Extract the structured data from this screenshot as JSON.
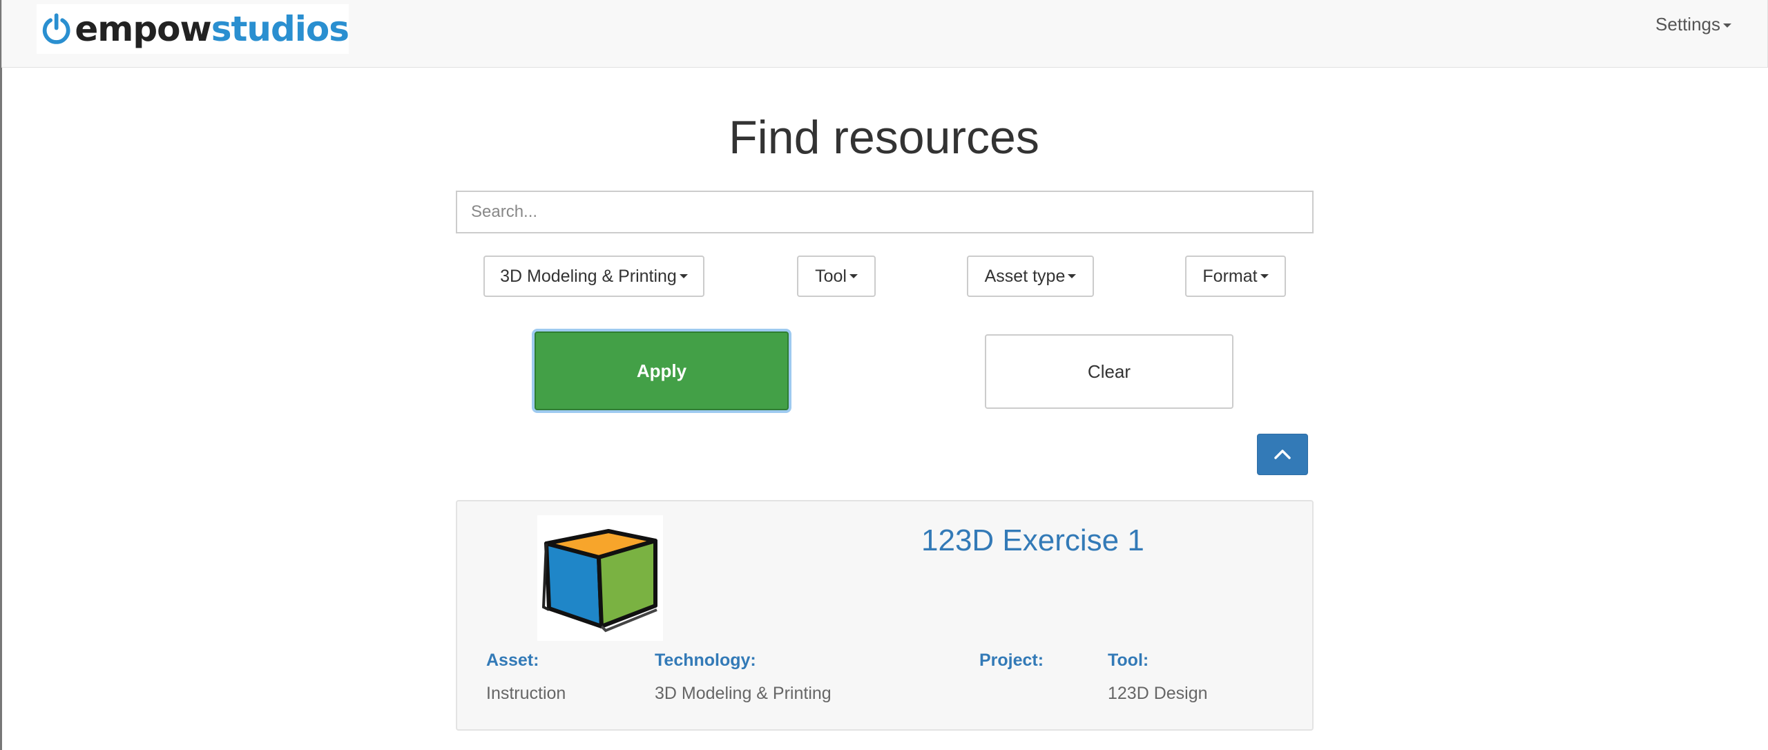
{
  "brand": {
    "logo_part1": "empow",
    "logo_part2": "studios"
  },
  "header": {
    "settings_label": "Settings"
  },
  "main": {
    "title": "Find resources",
    "search_placeholder": "Search...",
    "filters": [
      {
        "label": "3D Modeling & Printing"
      },
      {
        "label": "Tool"
      },
      {
        "label": "Asset type"
      },
      {
        "label": "Format"
      }
    ],
    "apply_label": "Apply",
    "clear_label": "Clear"
  },
  "results": [
    {
      "title": "123D Exercise 1",
      "asset_label": "Asset:",
      "asset_value": "Instruction",
      "technology_label": "Technology:",
      "technology_value": "3D Modeling & Printing",
      "project_label": "Project:",
      "project_value": "",
      "tool_label": "Tool:",
      "tool_value": "123D Design"
    }
  ],
  "colors": {
    "accent_blue": "#337ab7",
    "logo_blue": "#2a8fd0",
    "apply_green": "#43a047",
    "cube_orange": "#f7a52b",
    "cube_blue": "#1f86c8",
    "cube_green": "#7ab242"
  },
  "icons": {
    "logo": "power-icon",
    "scroll_top": "chevron-up-icon",
    "thumbnail": "cube-icon"
  }
}
